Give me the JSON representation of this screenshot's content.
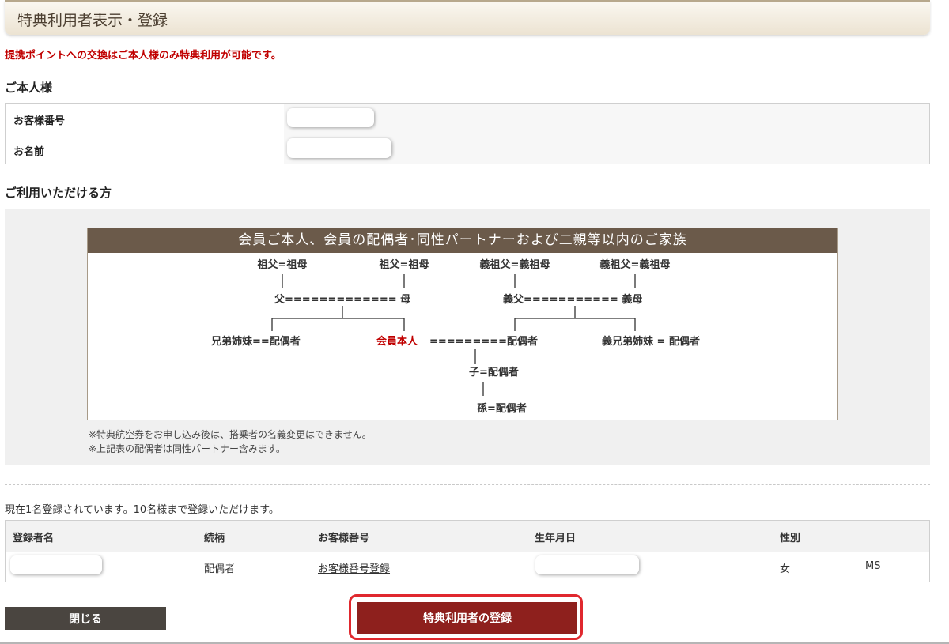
{
  "header": {
    "title": "特典利用者表示・登録"
  },
  "notice": "提携ポイントへの交換はご本人様のみ特典利用が可能です。",
  "self_section": {
    "title": "ご本人様",
    "rows": [
      {
        "label": "お客様番号"
      },
      {
        "label": "お名前"
      }
    ]
  },
  "eligible_section": {
    "title": "ご利用いただける方",
    "banner": "会員ご本人、会員の配偶者･同性パートナーおよび二親等以内のご家族",
    "tree": {
      "gp_paternal": "祖父=祖母",
      "gp_maternal": "祖父=祖母",
      "inlaw_gp_1": "義祖父=義祖母",
      "inlaw_gp_2": "義祖父=義祖母",
      "parents": "父============= 母",
      "inlaw_parents": "義父=========== 義母",
      "siblings": "兄弟姉妹==配偶者",
      "self": "会員本人",
      "spouse": "=========配偶者",
      "inlaw_siblings": "義兄弟姉妹 = 配偶者",
      "child": "子=配偶者",
      "grandchild": "孫=配偶者"
    },
    "notes": [
      "※特典航空券をお申し込み後は、搭乗者の名義変更はできません。",
      "※上記表の配偶者は同性パートナー含みます。"
    ]
  },
  "registered": {
    "count_text": "現在1名登録されています。10名様まで登録いただけます。",
    "columns": [
      "登録者名",
      "続柄",
      "お客様番号",
      "生年月日",
      "性別"
    ],
    "rows": [
      {
        "relation": "配偶者",
        "member_link": "お客様番号登録",
        "gender": "女",
        "title": "MS"
      }
    ]
  },
  "buttons": {
    "close": "閉じる",
    "register": "特典利用者の登録"
  },
  "colors": {
    "notice_red": "#c00000",
    "register_button": "#8e201d",
    "close_button": "#4a4540",
    "highlight": "#e0282e",
    "banner": "#6b5a4a"
  }
}
